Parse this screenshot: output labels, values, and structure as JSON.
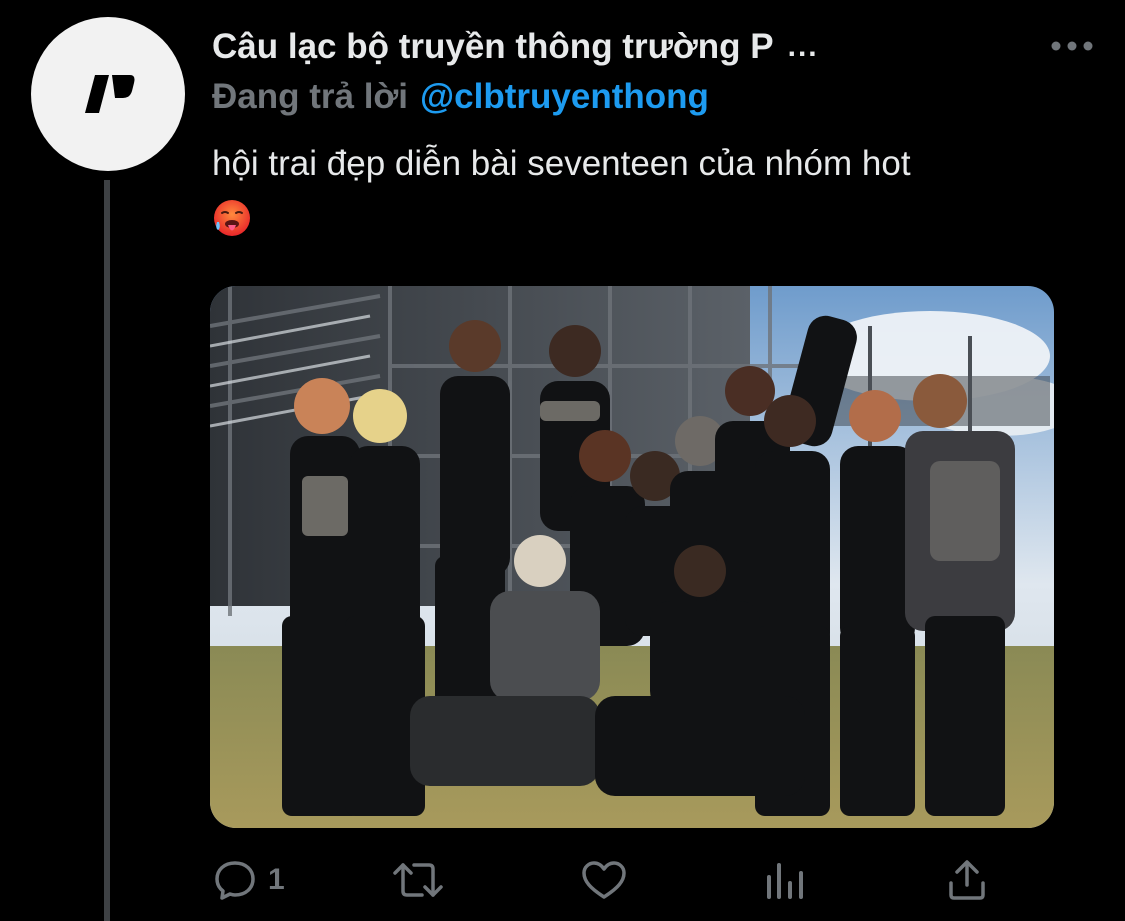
{
  "tweet": {
    "author_name": "Câu lạc bộ truyền thông trường P",
    "name_truncation": "...",
    "reply_prefix": "Đang trả lời",
    "reply_handle": "@clbtruyenthong",
    "text": "hội trai đẹp diễn bài seventeen của nhóm hot",
    "emoji": "hot-face-emoji",
    "photo": "group photo of thirteen young men in black stage outfits posing in front of scaffolding"
  },
  "actions": {
    "reply_count": "1",
    "retweet_count": "",
    "like_count": ""
  },
  "icons": {
    "more": "more-horizontal-icon",
    "reply": "reply-icon",
    "retweet": "retweet-icon",
    "like": "heart-icon",
    "stats": "analytics-icon",
    "share": "share-icon"
  },
  "colors": {
    "background": "#000000",
    "text": "#e7e9ea",
    "secondary": "#71767b",
    "accent": "#1d9bf0",
    "thread_line": "#3e4144"
  }
}
